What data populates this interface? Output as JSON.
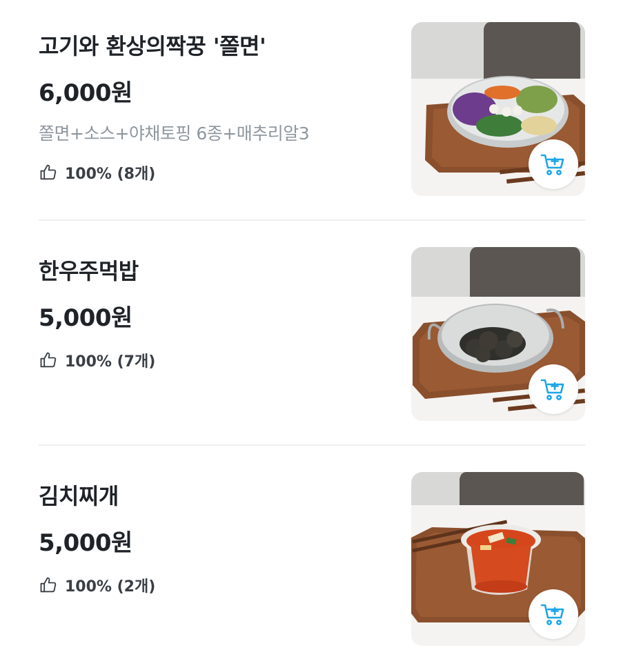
{
  "colors": {
    "accent": "#1ba6e8",
    "text": "#1f2328",
    "muted": "#8e969e",
    "divider": "#eef0f2"
  },
  "icons": {
    "like": "thumbs-up-icon",
    "cart": "cart-add-icon"
  },
  "menu": [
    {
      "name": "고기와 환상의짝꿍 '쫄면'",
      "price": "6,000원",
      "description": "쫄면+소스+야채토핑 6종+매추리알3",
      "rating": "100% (8개)"
    },
    {
      "name": "한우주먹밥",
      "price": "5,000원",
      "description": "",
      "rating": "100% (7개)"
    },
    {
      "name": "김치찌개",
      "price": "5,000원",
      "description": "",
      "rating": "100% (2개)"
    }
  ]
}
